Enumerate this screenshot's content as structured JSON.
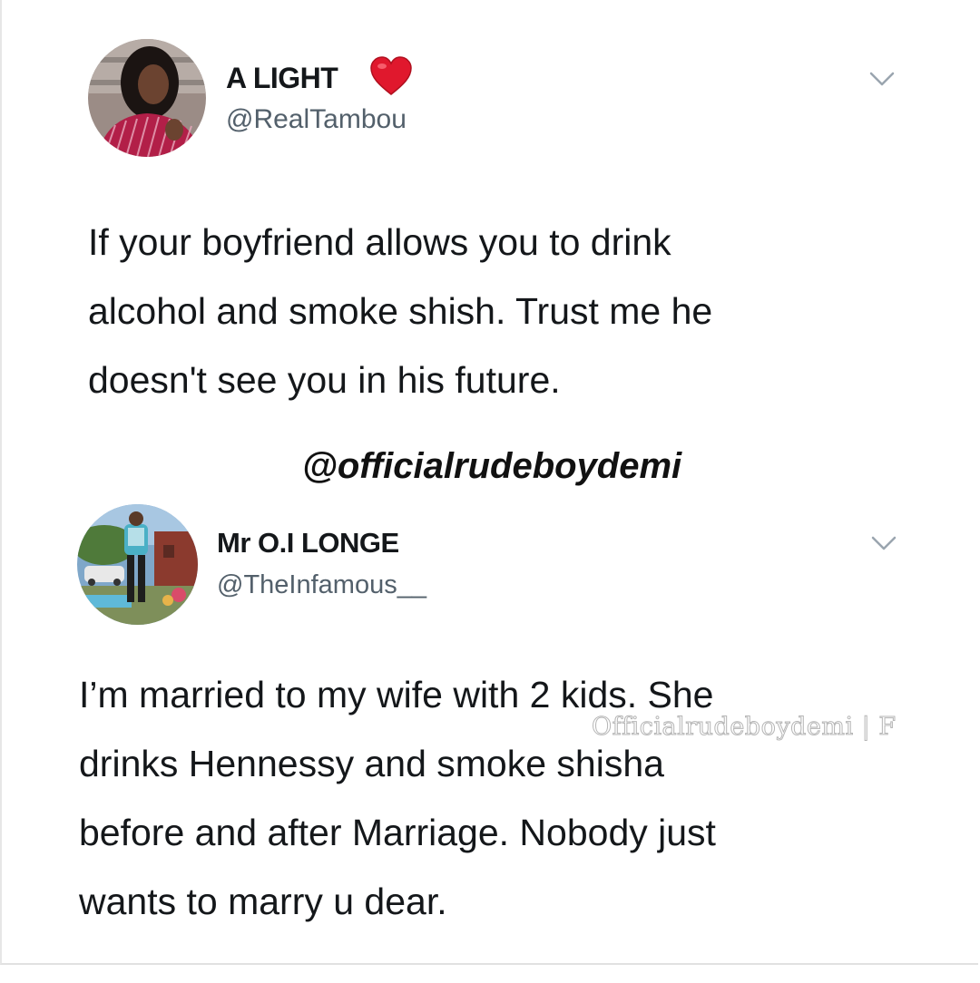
{
  "tweets": [
    {
      "display_name": "A LIGHT",
      "handle": "@RealTambou",
      "badge_icon": "heart-icon",
      "menu_icon": "chevron-down-icon",
      "avatar": "profile-photo",
      "text_lines": [
        "If your boyfriend allows you to drink",
        "alcohol and smoke shish. Trust me he",
        "doesn't see you in his future."
      ]
    },
    {
      "display_name": "Mr O.I LONGE",
      "handle": "@TheInfamous__",
      "menu_icon": "chevron-down-icon",
      "avatar": "profile-photo",
      "text_lines": [
        "I’m married to my wife with 2 kids. She",
        "drinks Hennessy and smoke shisha",
        "before and after Marriage. Nobody just",
        "wants to marry u dear."
      ]
    }
  ],
  "promo_tag": "@officialrudeboydemi",
  "watermark": "Officialrudeboydemi | F",
  "colors": {
    "heart": "#e0182d",
    "handle": "#53606b",
    "chevron": "#9aa5af"
  }
}
